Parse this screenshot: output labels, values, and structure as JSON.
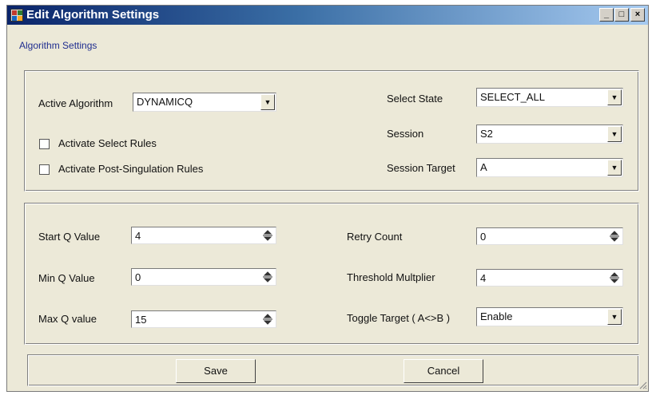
{
  "window": {
    "title": "Edit Algorithm Settings",
    "caption_buttons": {
      "minimize": "_",
      "maximize": "□",
      "close": "×"
    }
  },
  "tab": {
    "label": "Algorithm Settings"
  },
  "algorithm": {
    "active_algorithm_label": "Active Algorithm",
    "active_algorithm_value": "DYNAMICQ",
    "activate_select_rules_label": "Activate Select Rules",
    "activate_select_rules_checked": false,
    "activate_post_singulation_label": "Activate Post-Singulation Rules",
    "activate_post_singulation_checked": false,
    "select_state_label": "Select State",
    "select_state_value": "SELECT_ALL",
    "session_label": "Session",
    "session_value": "S2",
    "session_target_label": "Session Target",
    "session_target_value": "A"
  },
  "q_settings": {
    "start_q_label": "Start Q Value",
    "start_q_value": "4",
    "min_q_label": "Min Q Value",
    "min_q_value": "0",
    "max_q_label": "Max Q value",
    "max_q_value": "15",
    "retry_count_label": "Retry Count",
    "retry_count_value": "0",
    "threshold_multiplier_label": "Threshold Multplier",
    "threshold_multiplier_value": "4",
    "toggle_target_label": "Toggle Target ( A<>B )",
    "toggle_target_value": "Enable"
  },
  "buttons": {
    "save": "Save",
    "cancel": "Cancel"
  },
  "icons": {
    "app": "app-icon",
    "dropdown": "chevron-down-icon",
    "spinner": "spinner-icon",
    "grip": "resize-grip-icon"
  },
  "colors": {
    "titlebar_start": "#0a246a",
    "titlebar_end": "#a6caf0",
    "dialog_bg": "#ece9d8"
  }
}
